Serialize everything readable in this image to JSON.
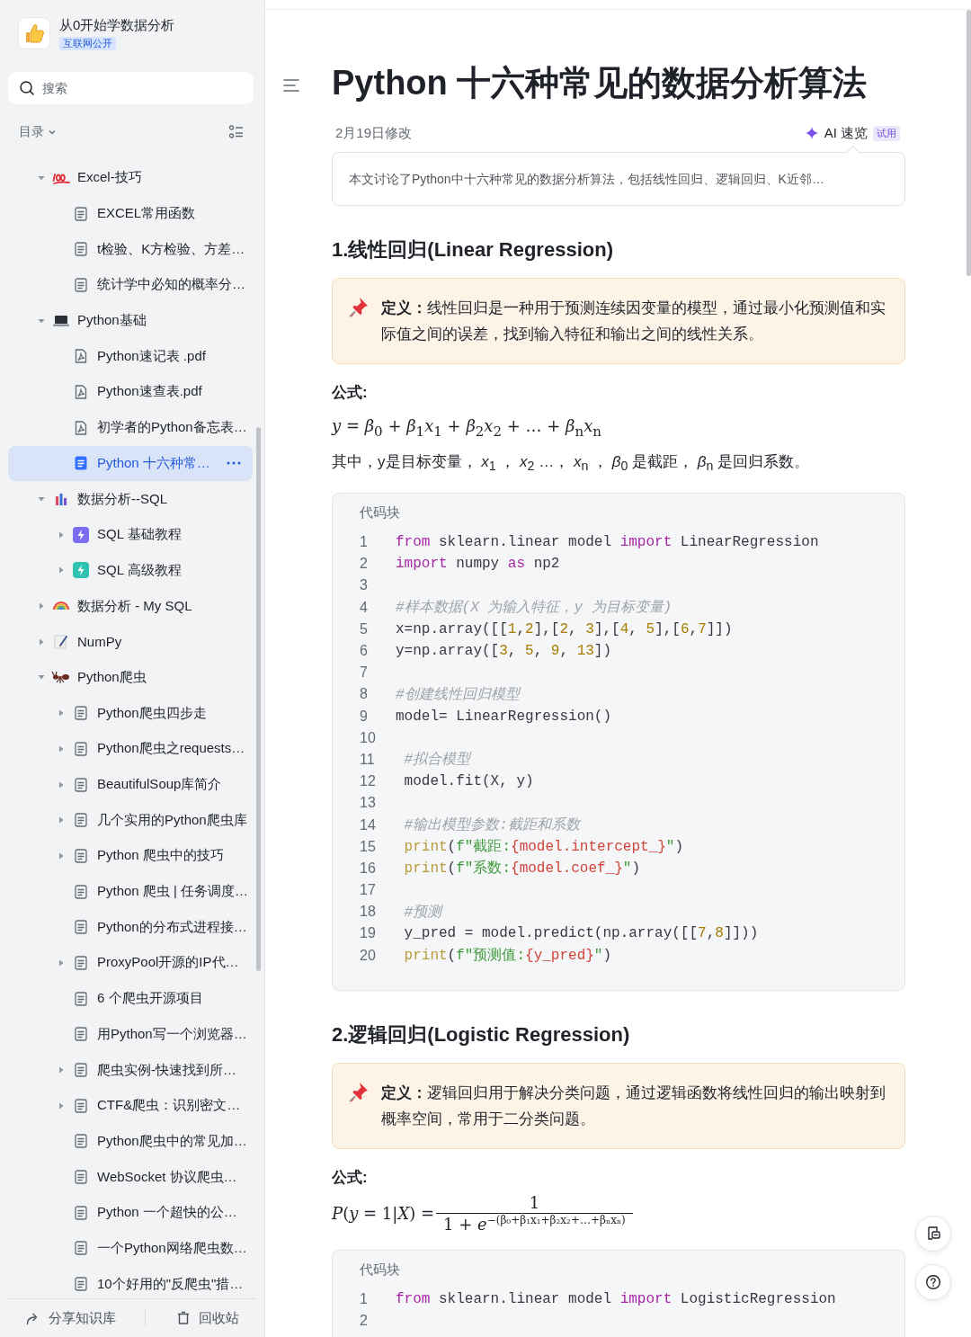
{
  "sidebar": {
    "space": {
      "title": "从0开始学数据分析",
      "badge": "互联网公开"
    },
    "search": {
      "placeholder": "搜索"
    },
    "toc_label": "目录",
    "tree": [
      {
        "label": "Excel-技巧",
        "kind": "hundred",
        "expanded": true,
        "selected": false,
        "children": [
          {
            "label": "EXCEL常用函数",
            "kind": "doc",
            "selected": false
          },
          {
            "label": "t检验、K方检验、方差…",
            "kind": "doc",
            "selected": false
          },
          {
            "label": "统计学中必知的概率分…",
            "kind": "doc",
            "selected": false
          }
        ]
      },
      {
        "label": "Python基础",
        "kind": "laptop",
        "expanded": true,
        "selected": false,
        "children": [
          {
            "label": "Python速记表 .pdf",
            "kind": "pdf",
            "selected": false
          },
          {
            "label": "Python速查表.pdf",
            "kind": "pdf",
            "selected": false
          },
          {
            "label": "初学者的Python备忘表…",
            "kind": "pdf",
            "selected": false
          },
          {
            "label": "Python 十六种常…",
            "kind": "doc",
            "selected": true
          }
        ]
      },
      {
        "label": "数据分析--SQL",
        "kind": "chart",
        "expanded": true,
        "selected": false,
        "children": [
          {
            "label": "SQL 基础教程",
            "kind": "bolt",
            "color": "#7c6cf2",
            "expanded": false,
            "selected": false
          },
          {
            "label": "SQL 高级教程",
            "kind": "bolt",
            "color": "#2fc2b0",
            "expanded": false,
            "selected": false
          }
        ]
      },
      {
        "label": "数据分析 - My SQL",
        "kind": "rainbow",
        "expanded": false,
        "selected": false
      },
      {
        "label": "NumPy",
        "kind": "memo",
        "expanded": false,
        "selected": false
      },
      {
        "label": "Python爬虫",
        "kind": "ant",
        "expanded": true,
        "selected": false,
        "children": [
          {
            "label": "Python爬虫四步走",
            "kind": "doc",
            "expanded": false,
            "selected": false
          },
          {
            "label": "Python爬虫之requests…",
            "kind": "doc",
            "expanded": false,
            "selected": false
          },
          {
            "label": "BeautifulSoup库简介",
            "kind": "doc",
            "expanded": false,
            "selected": false
          },
          {
            "label": "几个实用的Python爬虫库",
            "kind": "doc",
            "expanded": false,
            "selected": false
          },
          {
            "label": "Python 爬虫中的技巧",
            "kind": "doc",
            "expanded": false,
            "selected": false
          },
          {
            "label": "Python 爬虫 | 任务调度…",
            "kind": "doc",
            "selected": false
          },
          {
            "label": "Python的分布式进程接…",
            "kind": "doc",
            "selected": false
          },
          {
            "label": "ProxyPool开源的IP代…",
            "kind": "doc",
            "expanded": false,
            "selected": false
          },
          {
            "label": "6 个爬虫开源项目",
            "kind": "doc",
            "selected": false
          },
          {
            "label": "用Python写一个浏览器…",
            "kind": "doc",
            "selected": false
          },
          {
            "label": "爬虫实例-快速找到所…",
            "kind": "doc",
            "expanded": false,
            "selected": false
          },
          {
            "label": "CTF&爬虫：识别密文…",
            "kind": "doc",
            "expanded": false,
            "selected": false
          },
          {
            "label": "Python爬虫中的常见加…",
            "kind": "doc",
            "selected": false
          },
          {
            "label": "WebSocket 协议爬虫…",
            "kind": "doc",
            "selected": false
          },
          {
            "label": "Python 一个超快的公…",
            "kind": "doc",
            "selected": false
          },
          {
            "label": "一个Python网络爬虫数…",
            "kind": "doc",
            "selected": false
          },
          {
            "label": "10个好用的\"反爬虫\"措…",
            "kind": "doc",
            "selected": false
          }
        ]
      }
    ],
    "footer": [
      {
        "kind": "share",
        "label": "分享知识库"
      },
      {
        "kind": "trash",
        "label": "回收站"
      }
    ]
  },
  "document": {
    "title": "Python 十六种常见的数据分析算法",
    "modified": "2月19日修改",
    "ai": {
      "label": "AI 速览",
      "badge": "试用"
    },
    "summary": "本文讨论了Python中十六种常见的数据分析算法，包括线性回归、逻辑回归、K近邻…",
    "sections": [
      {
        "heading": "1.线性回归(Linear Regression)",
        "callout": "**定义：**线性回归是一种用于预测连续因变量的模型，通过最小化预测值和实际值之间的误差，找到输入特征和输出之间的线性关系。",
        "formula_label": "公式:",
        "formula": {
          "kind": "inline",
          "text": "*y* = *β*$_{0}$ + *β*$_{1}$*x*$_{1}$ + *β*$_{2}$*x*$_{2}$ + … + *β*$_{n}$*x*$_{n}$"
        },
        "explanation": "其中，y是目标变量， *x*$_{1}$ ， *x*$_{2}$ …， *x*$_{n}$ ， *β*$_{0}$ 是截距， *β*$_{n}$ 是回归系数。",
        "code": {
          "label": "代码块",
          "lines": [
            {
              "n": "1",
              "tokens": [
                {
                  "text": "from",
                  "kind": "keyword"
                },
                {
                  "text": " sklearn.linear model ",
                  "kind": "plain"
                },
                {
                  "text": "import",
                  "kind": "keyword"
                },
                {
                  "text": " LinearRegression",
                  "kind": "plain"
                }
              ]
            },
            {
              "n": "2",
              "tokens": [
                {
                  "text": "import",
                  "kind": "keyword"
                },
                {
                  "text": " numpy ",
                  "kind": "plain"
                },
                {
                  "text": "as",
                  "kind": "keyword"
                },
                {
                  "text": " np2",
                  "kind": "plain"
                }
              ]
            },
            {
              "n": "3"
            },
            {
              "n": "4",
              "tokens": [
                {
                  "text": "#样本数据(X 为输入特征，y 为目标变量)",
                  "kind": "comment"
                }
              ]
            },
            {
              "n": "5",
              "tokens": [
                {
                  "text": "x=np.array([[",
                  "kind": "plain"
                },
                {
                  "text": "1",
                  "kind": "number"
                },
                {
                  "text": ",",
                  "kind": "plain"
                },
                {
                  "text": "2",
                  "kind": "number"
                },
                {
                  "text": "],[",
                  "kind": "plain"
                },
                {
                  "text": "2",
                  "kind": "number"
                },
                {
                  "text": ", ",
                  "kind": "plain"
                },
                {
                  "text": "3",
                  "kind": "number"
                },
                {
                  "text": "],[",
                  "kind": "plain"
                },
                {
                  "text": "4",
                  "kind": "number"
                },
                {
                  "text": ", ",
                  "kind": "plain"
                },
                {
                  "text": "5",
                  "kind": "number"
                },
                {
                  "text": "],[",
                  "kind": "plain"
                },
                {
                  "text": "6",
                  "kind": "number"
                },
                {
                  "text": ",",
                  "kind": "plain"
                },
                {
                  "text": "7",
                  "kind": "number"
                },
                {
                  "text": "]])",
                  "kind": "plain"
                }
              ]
            },
            {
              "n": "6",
              "tokens": [
                {
                  "text": "y=np.array([",
                  "kind": "plain"
                },
                {
                  "text": "3",
                  "kind": "number"
                },
                {
                  "text": ", ",
                  "kind": "plain"
                },
                {
                  "text": "5",
                  "kind": "number"
                },
                {
                  "text": ", ",
                  "kind": "plain"
                },
                {
                  "text": "9",
                  "kind": "number"
                },
                {
                  "text": ", ",
                  "kind": "plain"
                },
                {
                  "text": "13",
                  "kind": "number"
                },
                {
                  "text": "])",
                  "kind": "plain"
                }
              ]
            },
            {
              "n": "7"
            },
            {
              "n": "8",
              "tokens": [
                {
                  "text": "#创建线性回归模型",
                  "kind": "comment"
                }
              ]
            },
            {
              "n": "9",
              "tokens": [
                {
                  "text": "model= LinearRegression()",
                  "kind": "plain"
                }
              ]
            },
            {
              "n": "10"
            },
            {
              "n": "11",
              "tokens": [
                {
                  "text": " #拟合模型",
                  "kind": "comment"
                }
              ]
            },
            {
              "n": "12",
              "tokens": [
                {
                  "text": " model.fit(X, y)",
                  "kind": "plain"
                }
              ]
            },
            {
              "n": "13"
            },
            {
              "n": "14",
              "tokens": [
                {
                  "text": " #输出模型参数:截距和系数",
                  "kind": "comment"
                }
              ]
            },
            {
              "n": "15",
              "tokens": [
                {
                  "text": " print",
                  "kind": "function"
                },
                {
                  "text": "(",
                  "kind": "plain"
                },
                {
                  "text": "f\"截距:",
                  "kind": "string"
                },
                {
                  "text": "{model.intercept_}",
                  "kind": "variable"
                },
                {
                  "text": "\"",
                  "kind": "string"
                },
                {
                  "text": ")",
                  "kind": "plain"
                }
              ]
            },
            {
              "n": "16",
              "tokens": [
                {
                  "text": " print",
                  "kind": "function"
                },
                {
                  "text": "(",
                  "kind": "plain"
                },
                {
                  "text": "f\"系数:",
                  "kind": "string"
                },
                {
                  "text": "{model.coef_}",
                  "kind": "variable"
                },
                {
                  "text": "\"",
                  "kind": "string"
                },
                {
                  "text": ")",
                  "kind": "plain"
                }
              ]
            },
            {
              "n": "17"
            },
            {
              "n": "18",
              "tokens": [
                {
                  "text": " #预测",
                  "kind": "comment"
                }
              ]
            },
            {
              "n": "19",
              "tokens": [
                {
                  "text": " y_pred = model.predict(np.array([[",
                  "kind": "plain"
                },
                {
                  "text": "7",
                  "kind": "number"
                },
                {
                  "text": ",",
                  "kind": "plain"
                },
                {
                  "text": "8",
                  "kind": "number"
                },
                {
                  "text": "]]))",
                  "kind": "plain"
                }
              ]
            },
            {
              "n": "20",
              "tokens": [
                {
                  "text": " print",
                  "kind": "function"
                },
                {
                  "text": "(",
                  "kind": "plain"
                },
                {
                  "text": "f\"预测值:",
                  "kind": "string"
                },
                {
                  "text": "{y_pred}",
                  "kind": "variable"
                },
                {
                  "text": "\"",
                  "kind": "string"
                },
                {
                  "text": ")",
                  "kind": "plain"
                }
              ]
            }
          ]
        }
      },
      {
        "heading": "2.逻辑回归(Logistic Regression)",
        "callout": "**定义：**逻辑回归用于解决分类问题，通过逻辑函数将线性回归的输出映射到概率空间，常用于二分类问题。",
        "formula_label": "公式:",
        "formula": {
          "kind": "fraction",
          "lhs": "*P*(*y* = 1|*X*) =",
          "numerator": "1",
          "denominator": "1 + *e*$^{−(β₀+β₁x₁+β₂x₂+…+βₙxₙ)}$"
        },
        "code": {
          "label": "代码块",
          "lines": [
            {
              "n": "1",
              "tokens": [
                {
                  "text": "from",
                  "kind": "keyword"
                },
                {
                  "text": " sklearn.linear model ",
                  "kind": "plain"
                },
                {
                  "text": "import",
                  "kind": "keyword"
                },
                {
                  "text": " LogisticRegression",
                  "kind": "plain"
                }
              ]
            },
            {
              "n": "2"
            }
          ]
        }
      }
    ]
  }
}
